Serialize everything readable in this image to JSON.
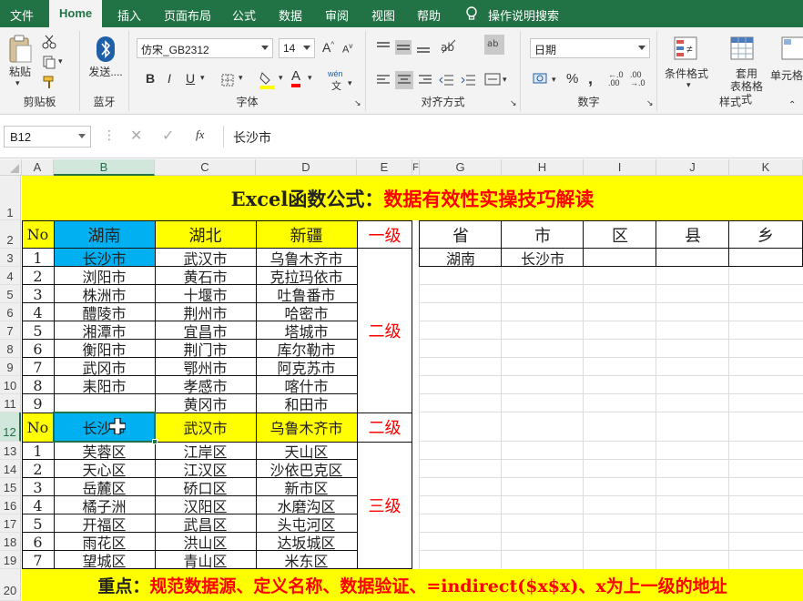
{
  "menu": {
    "tabs": [
      "文件",
      "Home",
      "插入",
      "页面布局",
      "公式",
      "数据",
      "审阅",
      "视图",
      "帮助"
    ],
    "tell_me": "操作说明搜索"
  },
  "ribbon": {
    "clipboard": {
      "label": "剪贴板",
      "paste": "粘贴"
    },
    "bluetooth": {
      "label": "蓝牙",
      "send": "发送...."
    },
    "font": {
      "label": "字体",
      "font_name": "仿宋_GB2312",
      "font_size": "14",
      "bold": "B",
      "italic": "I",
      "underline": "U",
      "font_color": "A",
      "phonetic": "wén"
    },
    "alignment": {
      "label": "对齐方式"
    },
    "number": {
      "label": "数字",
      "format": "日期",
      "percent": "%",
      "comma": ","
    },
    "styles": {
      "label": "样式",
      "conditional": "条件格式",
      "table_format": "套用\n表格格式",
      "cell_styles": "单元格"
    }
  },
  "formula_bar": {
    "name_box": "B12",
    "fx": "fx",
    "formula": "长沙市"
  },
  "grid": {
    "columns": [
      "A",
      "B",
      "C",
      "D",
      "E",
      "F",
      "G",
      "H",
      "I",
      "J",
      "K"
    ],
    "rows": [
      "1",
      "2",
      "3",
      "4",
      "5",
      "6",
      "7",
      "8",
      "9",
      "10",
      "11",
      "12",
      "13",
      "14",
      "15",
      "16",
      "17",
      "18",
      "19",
      "20"
    ],
    "title_black": "Excel函数公式：",
    "title_red": "数据有效性实操技巧解读",
    "footer_black": "重点：",
    "footer_red": "规范数据源、定义名称、数据验证、=indirect($x$x)、x为上一级的地址",
    "header_row": {
      "no": "No",
      "hunan": "湖南",
      "hubei": "湖北",
      "xinjiang": "新疆",
      "level": "一级"
    },
    "level2": "二级",
    "level2b": "二级",
    "level3": "三级",
    "no_label": "No",
    "block1": [
      {
        "no": "1",
        "b": "长沙市",
        "c": "武汉市",
        "d": "乌鲁木齐市"
      },
      {
        "no": "2",
        "b": "浏阳市",
        "c": "黄石市",
        "d": "克拉玛依市"
      },
      {
        "no": "3",
        "b": "株洲市",
        "c": "十堰市",
        "d": "吐鲁番市"
      },
      {
        "no": "4",
        "b": "醴陵市",
        "c": "荆州市",
        "d": "哈密市"
      },
      {
        "no": "5",
        "b": "湘潭市",
        "c": "宜昌市",
        "d": "塔城市"
      },
      {
        "no": "6",
        "b": "衡阳市",
        "c": "荆门市",
        "d": "库尔勒市"
      },
      {
        "no": "7",
        "b": "武冈市",
        "c": "鄂州市",
        "d": "阿克苏市"
      },
      {
        "no": "8",
        "b": "耒阳市",
        "c": "孝感市",
        "d": "喀什市"
      },
      {
        "no": "9",
        "b": "",
        "c": "黄冈市",
        "d": "和田市"
      }
    ],
    "row12": {
      "b": "长沙市",
      "c": "武汉市",
      "d": "乌鲁木齐市"
    },
    "block3": [
      {
        "no": "1",
        "b": "芙蓉区",
        "c": "江岸区",
        "d": "天山区"
      },
      {
        "no": "2",
        "b": "天心区",
        "c": "江汉区",
        "d": "沙依巴克区"
      },
      {
        "no": "3",
        "b": "岳麓区",
        "c": "硚口区",
        "d": "新市区"
      },
      {
        "no": "4",
        "b": "橘子洲",
        "c": "汉阳区",
        "d": "水磨沟区"
      },
      {
        "no": "5",
        "b": "开福区",
        "c": "武昌区",
        "d": "头屯河区"
      },
      {
        "no": "6",
        "b": "雨花区",
        "c": "洪山区",
        "d": "达坂城区"
      },
      {
        "no": "7",
        "b": "望城区",
        "c": "青山区",
        "d": "米东区"
      }
    ],
    "right_headers": [
      "省",
      "市",
      "区",
      "县",
      "乡"
    ],
    "right_values": [
      "湖南",
      "长沙市",
      "",
      "",
      ""
    ]
  },
  "colors": {
    "excel_green": "#217346",
    "yellow": "#ffff00",
    "blue_cell": "#00b0f0",
    "red_text": "#ff0000"
  }
}
